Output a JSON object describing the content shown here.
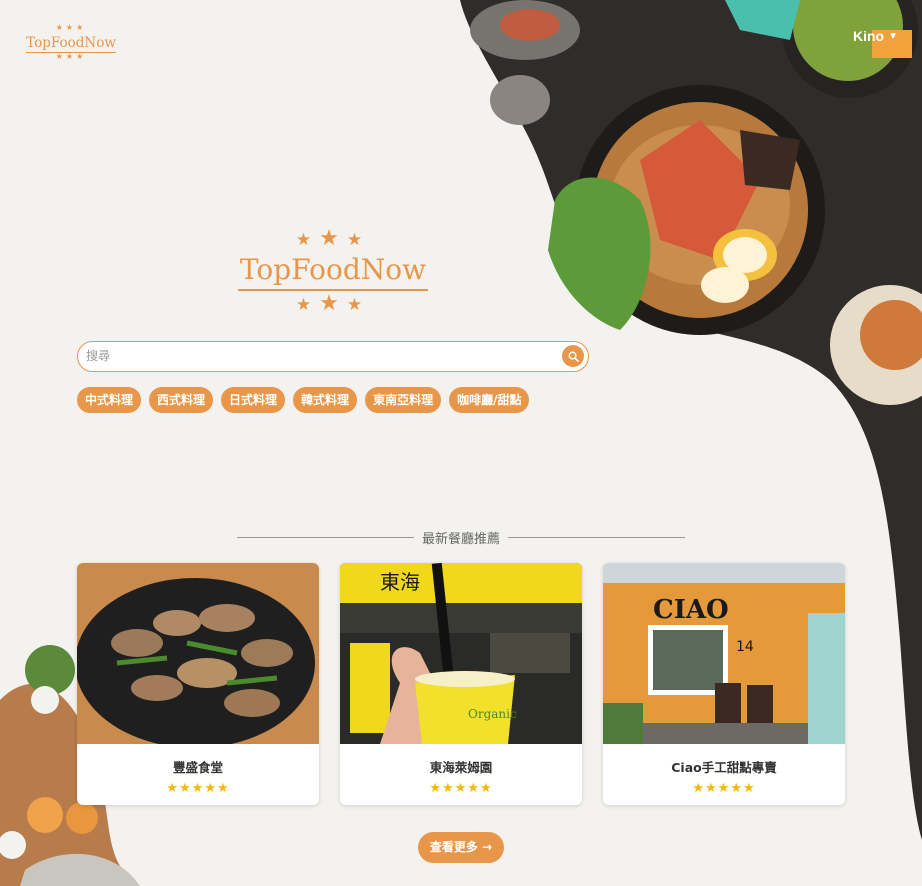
{
  "header": {
    "brand_small": "TopFoodNow",
    "user_name": "Kino"
  },
  "hero": {
    "brand_big": "TopFoodNow",
    "search_placeholder": "搜尋"
  },
  "categories": [
    "中式料理",
    "西式料理",
    "日式料理",
    "韓式料理",
    "東南亞料理",
    "咖啡廳/甜點"
  ],
  "section": {
    "title": "最新餐廳推薦"
  },
  "restaurants": [
    {
      "name": "豐盛食堂",
      "rating": "★★★★★"
    },
    {
      "name": "東海萊姆園",
      "rating": "★★★★★"
    },
    {
      "name": "Ciao手工甜點專賣",
      "rating": "★★★★★"
    }
  ],
  "photo_text": {
    "card2_sign": "東海",
    "card2_cup": "Organic",
    "card3_sign": "CIAO",
    "card3_number": "14"
  },
  "more_button": "查看更多 →",
  "colors": {
    "accent": "#e8964a",
    "star": "#f6b800",
    "wood": "#2f2c2a"
  }
}
